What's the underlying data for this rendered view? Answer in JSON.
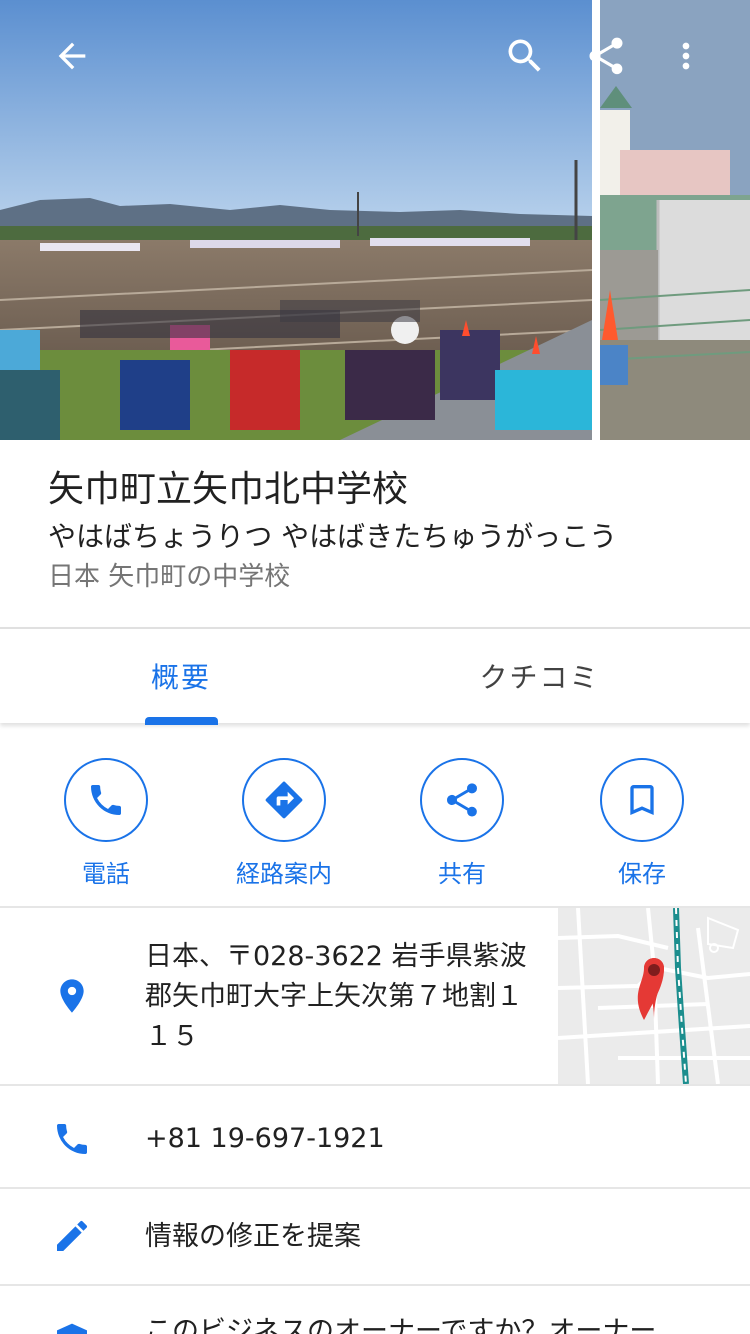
{
  "place": {
    "title": "矢巾町立矢巾北中学校",
    "reading": "やはばちょうりつ やはばきたちゅうがっこう",
    "category": "日本 矢巾町の中学校"
  },
  "tabs": [
    {
      "label": "概要",
      "selected": true
    },
    {
      "label": "クチコミ",
      "selected": false
    }
  ],
  "actions": [
    {
      "label": "電話",
      "icon": "phone-icon"
    },
    {
      "label": "経路案内",
      "icon": "directions-icon"
    },
    {
      "label": "共有",
      "icon": "share-icon"
    },
    {
      "label": "保存",
      "icon": "bookmark-icon"
    }
  ],
  "info": {
    "address": "日本、〒028-3622 岩手県紫波郡矢巾町大字上矢次第７地割１１５",
    "phone": "+81 19-697-1921",
    "suggest_edit": "情報の修正を提案",
    "owner_prompt": "このビジネスのオーナーですか？オーナー"
  },
  "colors": {
    "accent": "#1a73e8",
    "text_primary": "#212121",
    "text_secondary": "#757575",
    "divider": "#e6e6e6",
    "map_pin": "#e53935"
  },
  "header_icons": [
    "back-arrow-icon",
    "search-icon",
    "share-icon",
    "more-vert-icon"
  ]
}
